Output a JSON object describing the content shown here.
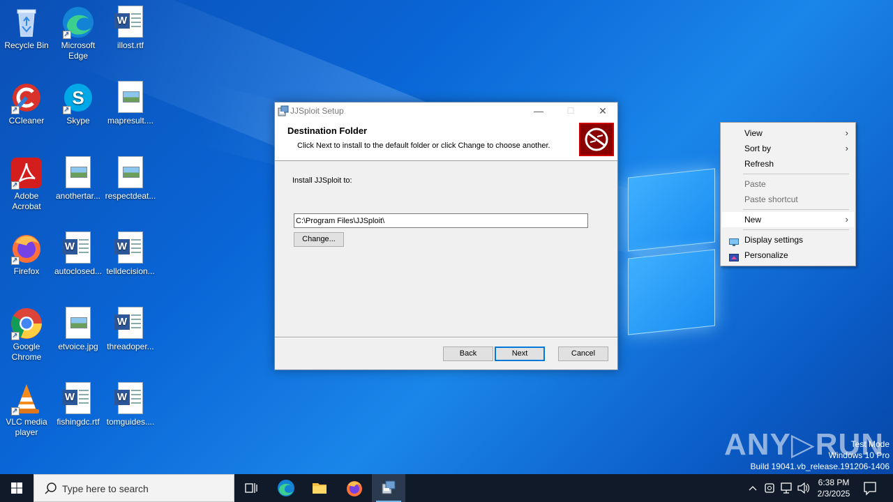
{
  "desktop": {
    "icons": [
      {
        "label": "Recycle Bin"
      },
      {
        "label": "Microsoft Edge"
      },
      {
        "label": "illost.rtf"
      },
      {
        "label": "CCleaner"
      },
      {
        "label": "Skype"
      },
      {
        "label": "mapresult...."
      },
      {
        "label": "Adobe Acrobat"
      },
      {
        "label": "anothertar..."
      },
      {
        "label": "respectdeat..."
      },
      {
        "label": "Firefox"
      },
      {
        "label": "autoclosed..."
      },
      {
        "label": "telldecision..."
      },
      {
        "label": "Google Chrome"
      },
      {
        "label": "etvoice.jpg"
      },
      {
        "label": "threadoper..."
      },
      {
        "label": "VLC media player"
      },
      {
        "label": "fishingdc.rtf"
      },
      {
        "label": "tomguides...."
      }
    ]
  },
  "dialog": {
    "title": "JJSploit Setup",
    "heading": "Destination Folder",
    "subheading": "Click Next to install to the default folder or click Change to choose another.",
    "install_label": "Install JJSploit to:",
    "install_path": "C:\\Program Files\\JJSploit\\",
    "change_button": "Change...",
    "back_button": "Back",
    "next_button": "Next",
    "cancel_button": "Cancel",
    "minimize_glyph": "—",
    "maximize_glyph": "☐",
    "close_glyph": "✕"
  },
  "context_menu": {
    "items": [
      {
        "label": "View",
        "submenu": true
      },
      {
        "label": "Sort by",
        "submenu": true
      },
      {
        "label": "Refresh"
      },
      {
        "label": "Paste",
        "disabled": true
      },
      {
        "label": "Paste shortcut",
        "disabled": true
      },
      {
        "label": "New",
        "submenu": true
      },
      {
        "label": "Display settings",
        "icon": "display-icon"
      },
      {
        "label": "Personalize",
        "icon": "personalize-icon"
      }
    ],
    "chevron": "›"
  },
  "watermark": {
    "brand": "ANY▷RUN",
    "line1": "Test Mode",
    "line2": "Windows 10 Pro",
    "line3": "Build 19041.vb_release.191206-1406"
  },
  "taskbar": {
    "search_placeholder": "Type here to search",
    "time": "6:38 PM",
    "date": "2/3/2025"
  },
  "colors": {
    "accent": "#0078d7",
    "taskbar": "#101a29",
    "wallpaper": "#0a66d6"
  }
}
